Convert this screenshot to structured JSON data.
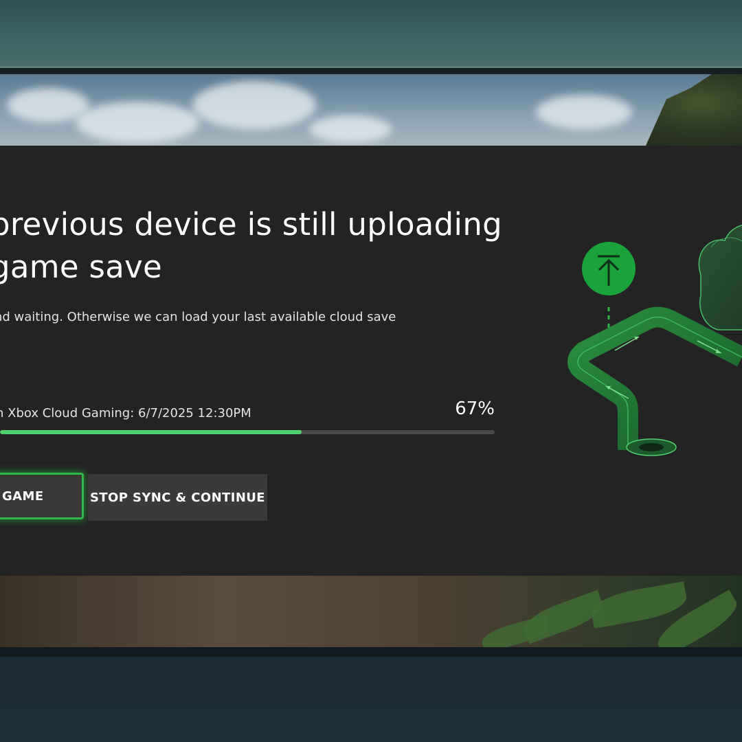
{
  "dialog": {
    "headline": "previous device is still uploading game save",
    "subtext": "nd waiting. Otherwise we can load your last available cloud save",
    "sync_label": "n Xbox Cloud Gaming: 6/7/2025 12:30PM",
    "sync_percent": "67%",
    "progress_fraction": 0.61
  },
  "buttons": {
    "primary_label": "GAME",
    "secondary_label": "STOP SYNC & CONTINUE"
  },
  "colors": {
    "accent": "#2fb84a",
    "progress": "#4fcf70",
    "panel": "#232323"
  },
  "icons": {
    "upload": "upload-arrow-icon",
    "illustration": "cloud-sync-path-illustration"
  }
}
